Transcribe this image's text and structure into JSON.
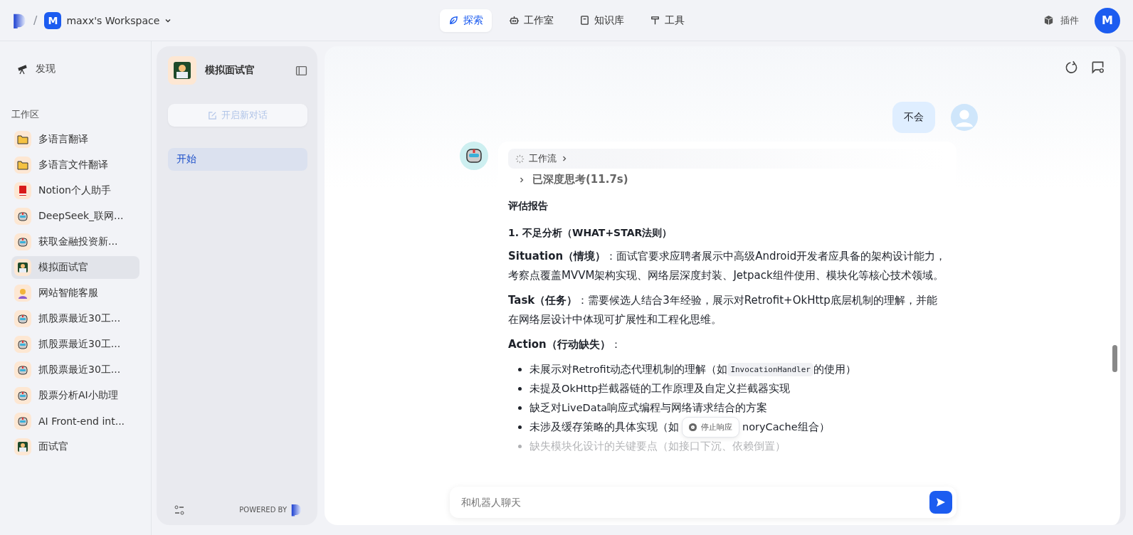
{
  "topbar": {
    "separator": "/",
    "workspace_initial": "M",
    "workspace_name": "maxx's Workspace",
    "nav": [
      {
        "label": "探索",
        "selected": true
      },
      {
        "label": "工作室",
        "selected": false
      },
      {
        "label": "知识库",
        "selected": false
      },
      {
        "label": "工具",
        "selected": false
      }
    ],
    "plugins": "插件",
    "avatar_initial": "M"
  },
  "sidebar": {
    "discover": "发现",
    "section": "工作区",
    "items": [
      {
        "label": "多语言翻译",
        "kind": "folder",
        "selected": false
      },
      {
        "label": "多语言文件翻译",
        "kind": "folder",
        "selected": false
      },
      {
        "label": "Notion个人助手",
        "kind": "book",
        "selected": false
      },
      {
        "label": "DeepSeek_联网...",
        "kind": "robot",
        "selected": false
      },
      {
        "label": "获取金融投资新...",
        "kind": "robot",
        "selected": false
      },
      {
        "label": "模拟面试官",
        "kind": "coder",
        "selected": true
      },
      {
        "label": "网站智能客服",
        "kind": "person",
        "selected": false
      },
      {
        "label": "抓股票最近30工...",
        "kind": "robot",
        "selected": false
      },
      {
        "label": "抓股票最近30工...",
        "kind": "robot",
        "selected": false
      },
      {
        "label": "抓股票最近30工...",
        "kind": "robot",
        "selected": false
      },
      {
        "label": "股票分析AI小助理",
        "kind": "robot",
        "selected": false
      },
      {
        "label": "AI Front-end int...",
        "kind": "robot",
        "selected": false
      },
      {
        "label": "面试官",
        "kind": "coder",
        "selected": false
      }
    ]
  },
  "app_panel": {
    "title": "模拟面试官",
    "new_chat": "开启新对话",
    "conversations": [
      {
        "label": "开始",
        "selected": true
      }
    ],
    "powered_by": "POWERED BY"
  },
  "chat": {
    "user_message": "不会",
    "workflow": "工作流",
    "thinking": "已深度思考(11.7s)",
    "report_title": "评估报告",
    "section_title": "1. 不足分析（WHAT+STAR法则）",
    "paragraphs": [
      {
        "label": "Situation（情境）",
        "text": "：面试官要求应聘者展示中高级Android开发者应具备的架构设计能力，考察点覆盖MVVM架构实现、网络层深度封装、Jetpack组件使用、模块化等核心技术领域。"
      },
      {
        "label": "Task（任务）",
        "text": "：需要候选人结合3年经验，展示对Retrofit+OkHttp底层机制的理解，并能在网络层设计中体现可扩展性和工程化思维。"
      }
    ],
    "action_label": "Action（行动缺失）",
    "action_colon": "：",
    "bullets": [
      {
        "kind": "code",
        "before": "未展示对Retrofit动态代理机制的理解（如",
        "code": "InvocationHandler",
        "after": "的使用）"
      },
      {
        "kind": "plain",
        "before": "未提及OkHttp拦截器链的工作原理及自定义拦截器实现"
      },
      {
        "kind": "plain",
        "before": "缺乏对LiveData响应式编程与网络请求结合的方案"
      },
      {
        "kind": "stop",
        "before": "未涉及缓存策略的具体实现（如",
        "after": "noryCache组合）"
      },
      {
        "kind": "faded",
        "before": "缺失模块化设计的关键要点（如接口下沉、依赖倒置）"
      }
    ],
    "stop_button": "停止响应",
    "input_placeholder": "和机器人聊天"
  }
}
